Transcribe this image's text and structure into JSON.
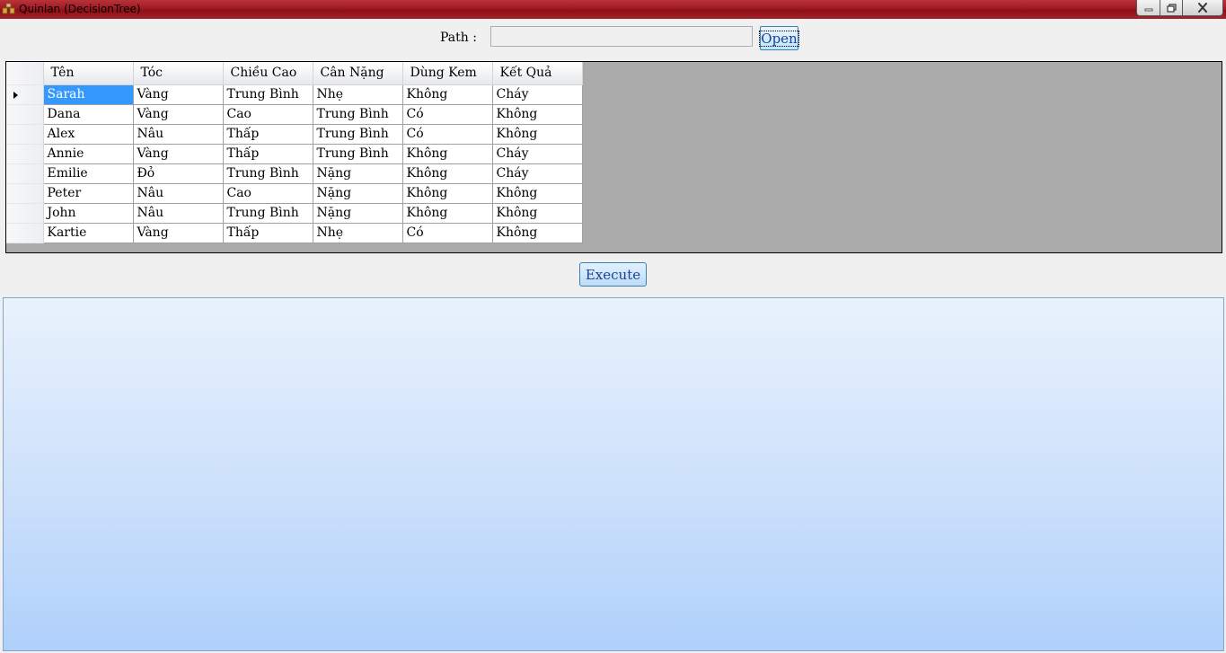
{
  "window": {
    "title": "Quinlan (DecisionTree)",
    "controls": [
      "minimize",
      "maximize",
      "close"
    ]
  },
  "path": {
    "label": "Path :",
    "value": "",
    "open_label": "Open"
  },
  "grid": {
    "columns": [
      "Tên",
      "Tóc",
      "Chiều Cao",
      "Cân Nặng",
      "Dùng Kem",
      "Kết Quả"
    ],
    "rows": [
      [
        "Sarah",
        "Vàng",
        "Trung Bình",
        "Nhẹ",
        "Không",
        "Cháy"
      ],
      [
        "Dana",
        "Vàng",
        "Cao",
        "Trung Bình",
        "Có",
        "Không"
      ],
      [
        "Alex",
        "Nâu",
        "Thấp",
        "Trung Bình",
        "Có",
        "Không"
      ],
      [
        "Annie",
        "Vàng",
        "Thấp",
        "Trung Bình",
        "Không",
        "Cháy"
      ],
      [
        "Emilie",
        "Đỏ",
        "Trung Bình",
        "Nặng",
        "Không",
        "Cháy"
      ],
      [
        "Peter",
        "Nâu",
        "Cao",
        "Nặng",
        "Không",
        "Không"
      ],
      [
        "John",
        "Nâu",
        "Trung Bình",
        "Nặng",
        "Không",
        "Không"
      ],
      [
        "Kartie",
        "Vàng",
        "Thấp",
        "Nhẹ",
        "Có",
        "Không"
      ]
    ],
    "selected_row": 0,
    "selected_col": 0
  },
  "actions": {
    "execute_label": "Execute"
  },
  "colors": {
    "titlebar": "#a11a22",
    "selection": "#3399ff",
    "button_text": "#1f3f9a"
  }
}
